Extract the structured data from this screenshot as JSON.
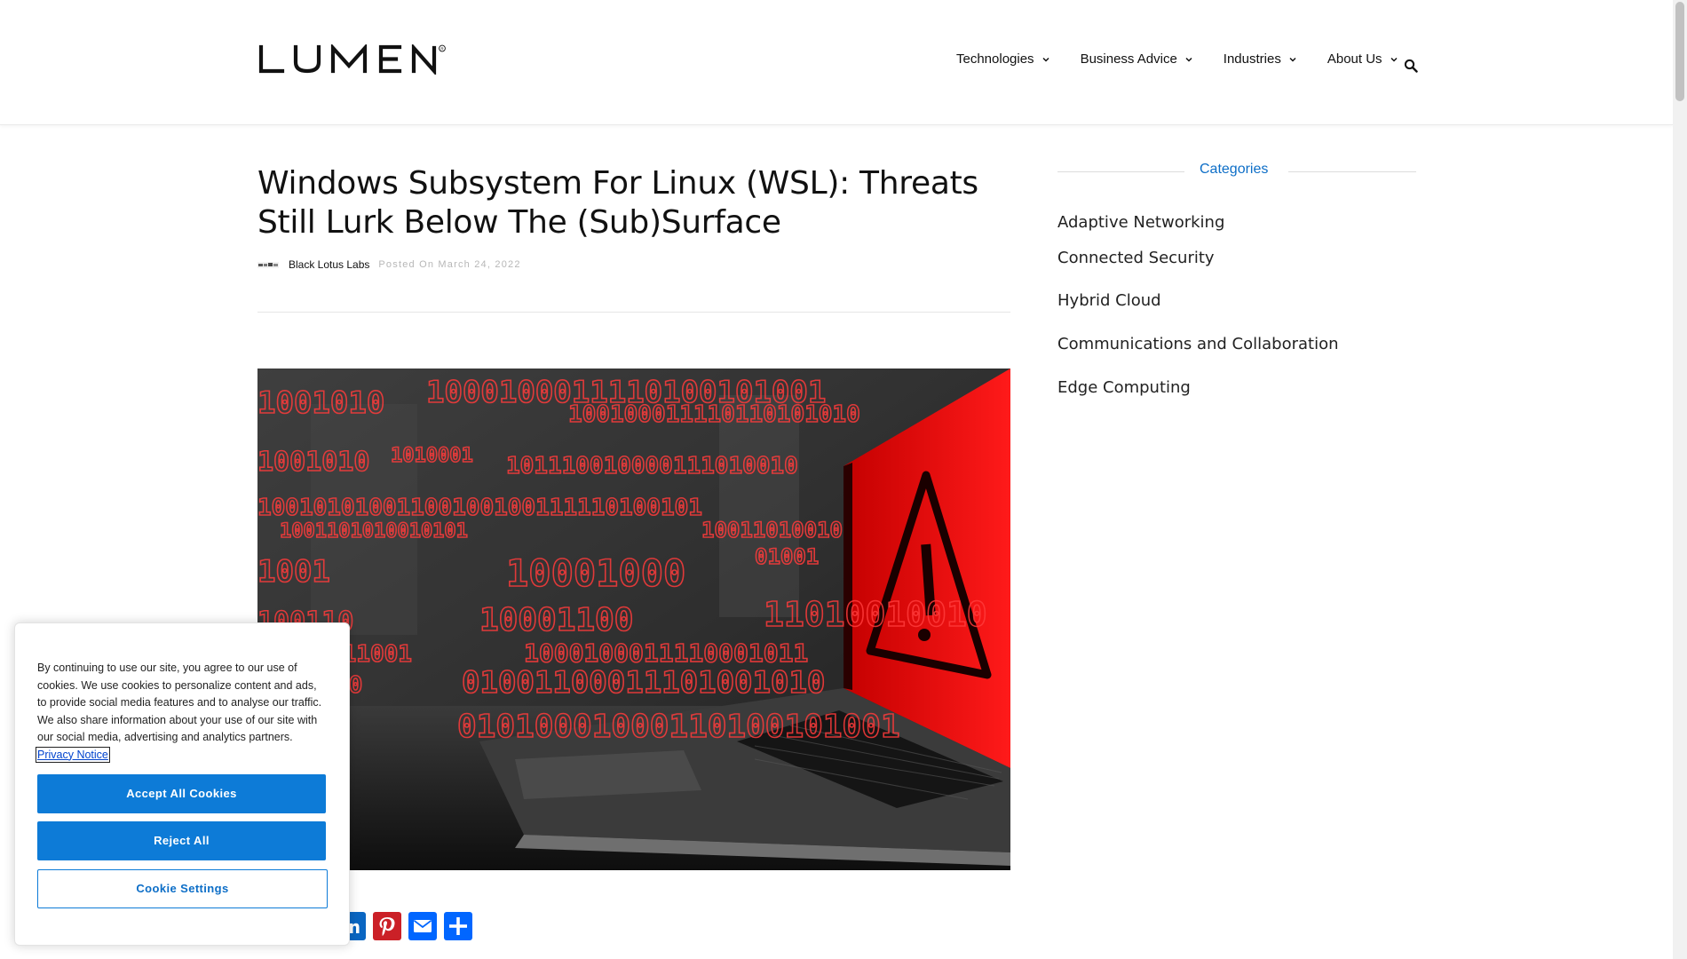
{
  "brand": {
    "logo_text": "LUMEN",
    "registered_mark": "®"
  },
  "nav": {
    "items": [
      {
        "label": "Technologies"
      },
      {
        "label": "Business Advice"
      },
      {
        "label": "Industries"
      },
      {
        "label": "About Us"
      }
    ]
  },
  "article": {
    "title": "Windows Subsystem For Linux (WSL): Threats Still Lurk Below The (Sub)Surface",
    "author": "Black Lotus Labs",
    "posted": "Posted On March 24, 2022",
    "hero_alt": "Laptop with red binary code and warning triangle",
    "share_buttons": [
      "linkedin-icon",
      "pinterest-icon",
      "email-icon",
      "share-icon"
    ]
  },
  "sidebar": {
    "title": "Categories",
    "items": [
      {
        "label": "Adaptive Networking"
      },
      {
        "label": "Connected Security"
      },
      {
        "label": "Hybrid Cloud"
      },
      {
        "label": "Communications and Collaboration"
      },
      {
        "label": "Edge Computing"
      }
    ]
  },
  "cookie_banner": {
    "text": "By continuing to use our site, you agree to our use of cookies. We use cookies to personalize content and ads, to provide social media features and to analyse our traffic. We also share information about your use of our site with our social media, advertising and analytics partners.",
    "privacy_link": "Privacy Notice",
    "accept_label": "Accept All Cookies",
    "reject_label": "Reject All",
    "settings_label": "Cookie Settings"
  },
  "colors": {
    "accent": "#0d7bd7",
    "link": "#0d6ec7",
    "pinterest": "#cb2027",
    "share_blue": "#0166ff"
  }
}
